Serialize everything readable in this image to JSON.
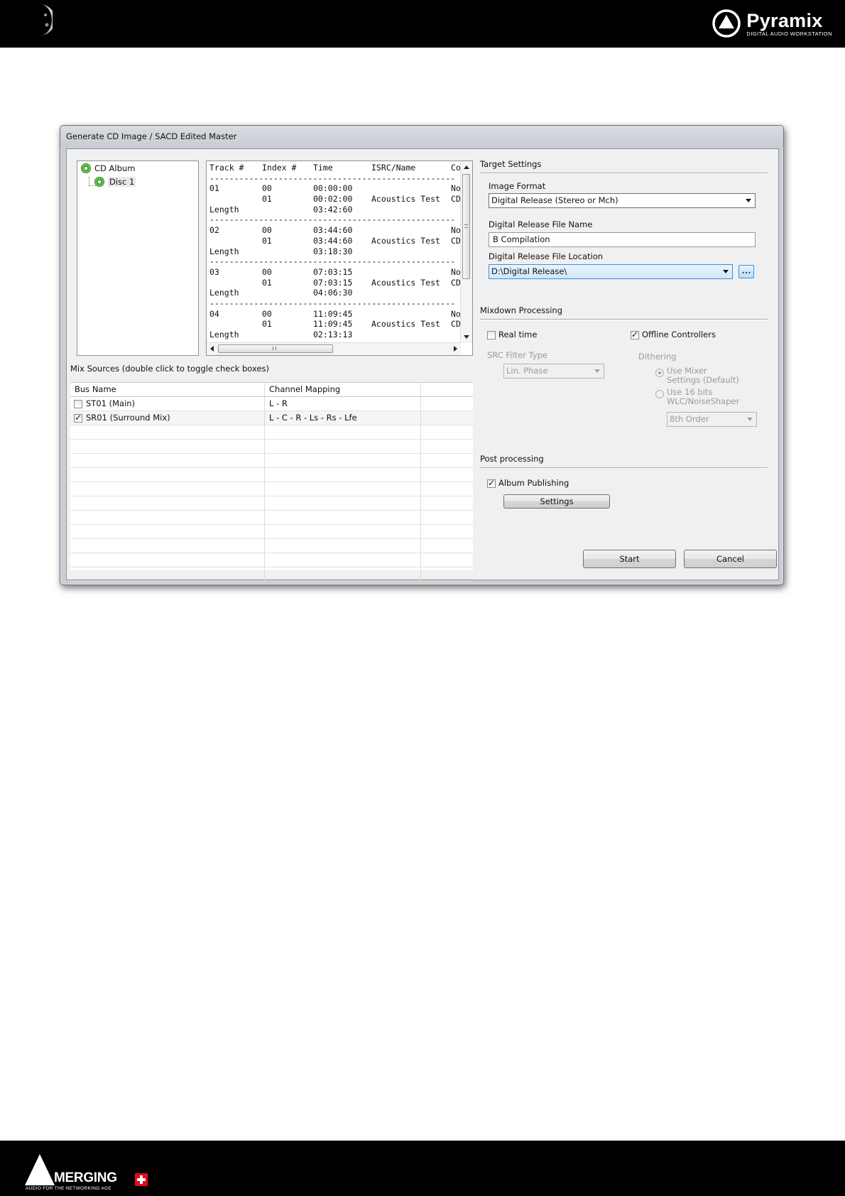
{
  "page": {
    "brand_name": "Pyramix",
    "brand_tagline": "DIGITAL AUDIO WORKSTATION",
    "footer_brand": "MERGING",
    "footer_tagline": "AUDIO FOR THE NETWORKING AGE"
  },
  "dialog": {
    "title": "Generate CD Image / SACD Edited Master",
    "tree": {
      "root": "CD Album",
      "child": "Disc 1"
    },
    "tracks": {
      "headers": [
        "Track #",
        "Index #",
        "Time",
        "ISRC/Name",
        "Co"
      ],
      "separator": "--------------------------------------------------",
      "length_label": "Length",
      "rows": [
        {
          "track": "01",
          "idx": [
            "00",
            "01"
          ],
          "times": [
            "00:00:00",
            "00:02:00"
          ],
          "name": "Acoustics Test",
          "co": [
            "No",
            "CD"
          ],
          "length": "03:42:60"
        },
        {
          "track": "02",
          "idx": [
            "00",
            "01"
          ],
          "times": [
            "03:44:60",
            "03:44:60"
          ],
          "name": "Acoustics Test",
          "co": [
            "No",
            "CD"
          ],
          "length": "03:18:30"
        },
        {
          "track": "03",
          "idx": [
            "00",
            "01"
          ],
          "times": [
            "07:03:15",
            "07:03:15"
          ],
          "name": "Acoustics Test",
          "co": [
            "No",
            "CD"
          ],
          "length": "04:06:30"
        },
        {
          "track": "04",
          "idx": [
            "00",
            "01"
          ],
          "times": [
            "11:09:45",
            "11:09:45"
          ],
          "name": "Acoustics Test",
          "co": [
            "No",
            "CD"
          ],
          "length": "02:13:13"
        }
      ]
    },
    "mix_sources": {
      "label": "Mix Sources (double click to toggle check boxes)",
      "col_bus": "Bus Name",
      "col_mapping": "Channel Mapping",
      "rows": [
        {
          "bus": "ST01 (Main)",
          "mapping": "L - R",
          "checked": false
        },
        {
          "bus": "SR01 (Surround Mix)",
          "mapping": "L - C - R - Ls - Rs - Lfe",
          "checked": true
        }
      ]
    },
    "target": {
      "title": "Target Settings",
      "image_format_label": "Image Format",
      "image_format_value": "Digital Release (Stereo or Mch)",
      "file_name_label": "Digital Release File Name",
      "file_name_value": "B Compilation",
      "file_location_label": "Digital Release File Location",
      "file_location_value": "D:\\Digital Release\\",
      "browse_label": "..."
    },
    "mixdown": {
      "title": "Mixdown Processing",
      "realtime_label": "Real time",
      "realtime_checked": false,
      "offline_label": "Offline Controllers",
      "offline_checked": true,
      "src_label": "SRC Filter Type",
      "src_value": "Lin. Phase",
      "dithering_label": "Dithering",
      "dither_opt1_line1": "Use Mixer",
      "dither_opt1_line2": "Settings (Default)",
      "dither_opt2_line1": "Use 16 bits",
      "dither_opt2_line2": "WLC/NoiseShaper",
      "order_value": "8th Order"
    },
    "post": {
      "title": "Post processing",
      "album_publishing_label": "Album Publishing",
      "album_publishing_checked": true,
      "settings_button": "Settings"
    },
    "start_button": "Start",
    "cancel_button": "Cancel"
  }
}
